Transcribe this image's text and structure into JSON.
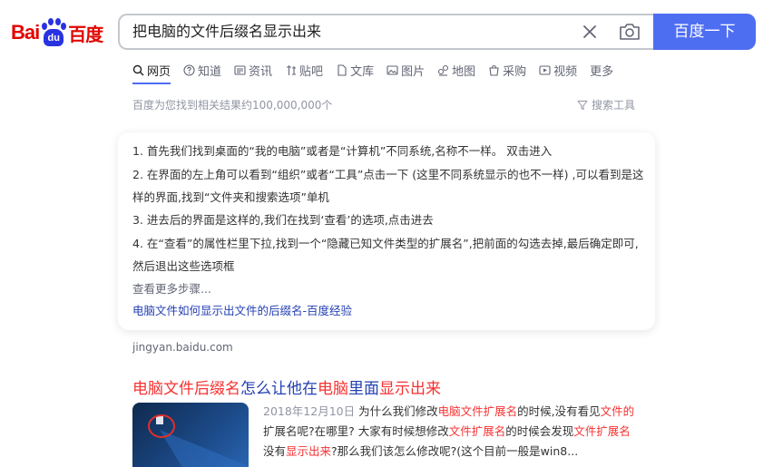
{
  "logo": {
    "text_left": "Bai",
    "text_paw": "du",
    "text_right": "百度"
  },
  "search": {
    "query": "把电脑的文件后缀名显示出来",
    "button_label": "百度一下"
  },
  "tabs": [
    {
      "label": "网页",
      "icon": "search-icon"
    },
    {
      "label": "知道",
      "icon": "question-icon"
    },
    {
      "label": "资讯",
      "icon": "news-icon"
    },
    {
      "label": "贴吧",
      "icon": "tieba-icon"
    },
    {
      "label": "文库",
      "icon": "document-icon"
    },
    {
      "label": "图片",
      "icon": "image-icon"
    },
    {
      "label": "地图",
      "icon": "map-icon"
    },
    {
      "label": "采购",
      "icon": "shopping-icon"
    },
    {
      "label": "视频",
      "icon": "video-icon"
    },
    {
      "label": "更多",
      "icon": ""
    }
  ],
  "result_count": "百度为您找到相关结果约100,000,000个",
  "search_tools": "搜索工具",
  "card": {
    "steps": [
      "1. 首先我们找到桌面的“我的电脑”或者是“计算机”不同系统,名称不一样。 双击进入",
      "2. 在界面的左上角可以看到“组织”或者“工具”点击一下 (这里不同系统显示的也不一样) ,可以看到是这样的界面,找到“文件夹和搜索选项”单机",
      "3. 进去后的界面是这样的,我们在找到‘查看’的选项,点击进去",
      "4. 在“查看”的属性栏里下拉,找到一个“隐藏已知文件类型的扩展名”,把前面的勾选去掉,最后确定即可,然后退出这些选项框"
    ],
    "more_steps": "查看更多步骤...",
    "link": "电脑文件如何显示出文件的后缀名-百度经验"
  },
  "source_url": "jingyan.baidu.com",
  "result": {
    "title_parts": [
      {
        "text": "电脑文件后缀名",
        "hl": true
      },
      {
        "text": "怎么让他在",
        "hl": false
      },
      {
        "text": "电脑",
        "hl": true
      },
      {
        "text": "里面",
        "hl": false
      },
      {
        "text": "显示出来",
        "hl": true
      }
    ],
    "date": "2018年12月10日",
    "snippet_parts": [
      {
        "text": " 为什么我们修改",
        "hl": false
      },
      {
        "text": "电脑文件扩展名",
        "hl": true
      },
      {
        "text": "的时候,没有看见",
        "hl": false
      },
      {
        "text": "文件的",
        "hl": true
      },
      {
        "text": "扩展名呢?在哪里? 大家有时候想修改",
        "hl": false
      },
      {
        "text": "文件扩展名",
        "hl": true
      },
      {
        "text": "的时候会发现",
        "hl": false
      },
      {
        "text": "文件扩展名",
        "hl": true
      },
      {
        "text": "没有",
        "hl": false
      },
      {
        "text": "显示出来",
        "hl": true
      },
      {
        "text": "?那么我们该怎么修改呢?(这个目前一般是win8...",
        "hl": false
      }
    ]
  },
  "colors": {
    "accent": "#4e6ef2",
    "link": "#2440b3",
    "highlight": "#f73131",
    "brand_red": "#e10601",
    "brand_blue": "#2932e1"
  }
}
